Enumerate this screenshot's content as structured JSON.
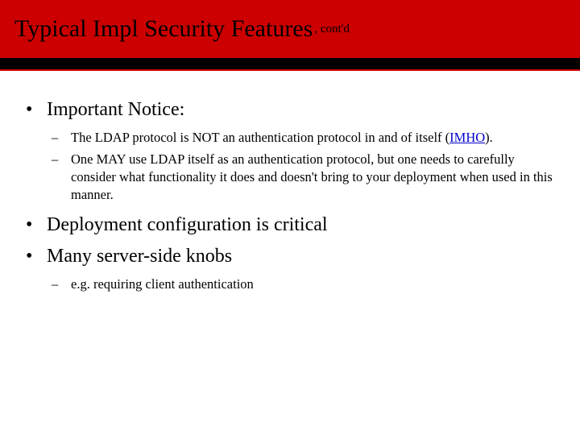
{
  "title": {
    "main": "Typical Impl Security Features",
    "sub": ", cont'd"
  },
  "bullets": {
    "b1": "Important Notice:",
    "b1_sub1_a": "The LDAP protocol is NOT an authentication protocol in and of itself (",
    "b1_sub1_link": "IMHO",
    "b1_sub1_b": ").",
    "b1_sub2": "One MAY use LDAP itself as an authentication protocol, but one needs to carefully consider what functionality it does and doesn't bring to your deployment when used in this manner.",
    "b2": "Deployment configuration is critical",
    "b3": "Many server-side knobs",
    "b3_sub1": "e.g. requiring client authentication"
  }
}
